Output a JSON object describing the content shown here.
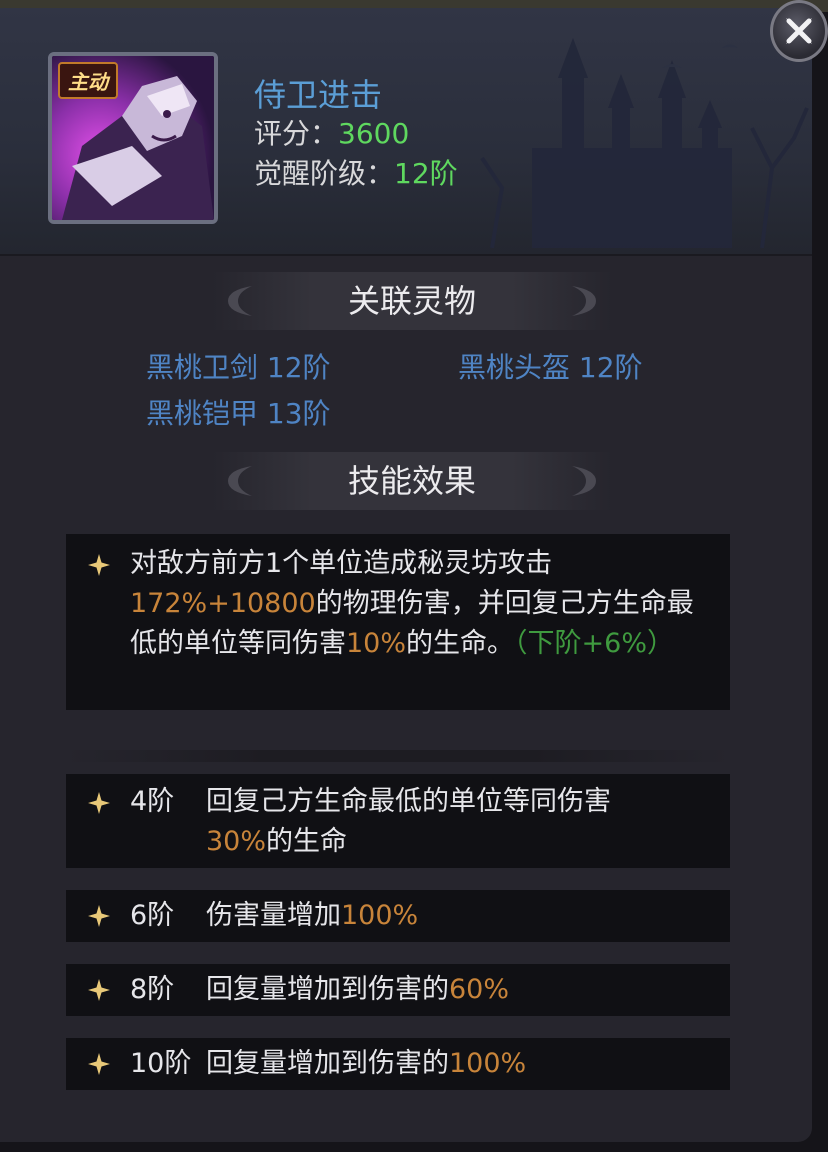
{
  "skill": {
    "type_tag": "主动",
    "name": "侍卫进击",
    "score_label": "评分：",
    "score_value": "3600",
    "awaken_label": "觉醒阶级：",
    "awaken_value": "12阶"
  },
  "related": {
    "title": "关联灵物",
    "items": [
      "黑桃卫剑 12阶",
      "黑桃头盔 12阶",
      "黑桃铠甲 13阶"
    ]
  },
  "effects": {
    "title": "技能效果",
    "main": {
      "part1": "对敌方前方1个单位造成秘灵坊攻击",
      "part2": "172%+10800",
      "part3": "的物理伤害，并回复己方生命最低的单位等同伤害",
      "part4": "10%",
      "part5": "的生命。",
      "part6": "（下阶+6%）"
    },
    "levels": [
      {
        "level": "4阶",
        "text": "回复己方生命最低的单位等同伤害",
        "highlight": "30%",
        "suffix": "的生命"
      },
      {
        "level": "6阶",
        "text": "伤害量增加",
        "highlight": "100%",
        "suffix": ""
      },
      {
        "level": "8阶",
        "text": "回复量增加到伤害的",
        "highlight": "60%",
        "suffix": ""
      },
      {
        "level": "10阶",
        "text": "回复量增加到伤害的",
        "highlight": "100%",
        "suffix": ""
      }
    ]
  },
  "colors": {
    "name": "#5b9ed6",
    "green_value": "#5fd85f",
    "related_link": "#4f84c4",
    "highlight": "#c8843a",
    "next_level": "#3f9a3f",
    "star": "#e8c878"
  },
  "icons": {
    "close": "close-x-icon",
    "bullet": "four-point-star-icon"
  }
}
